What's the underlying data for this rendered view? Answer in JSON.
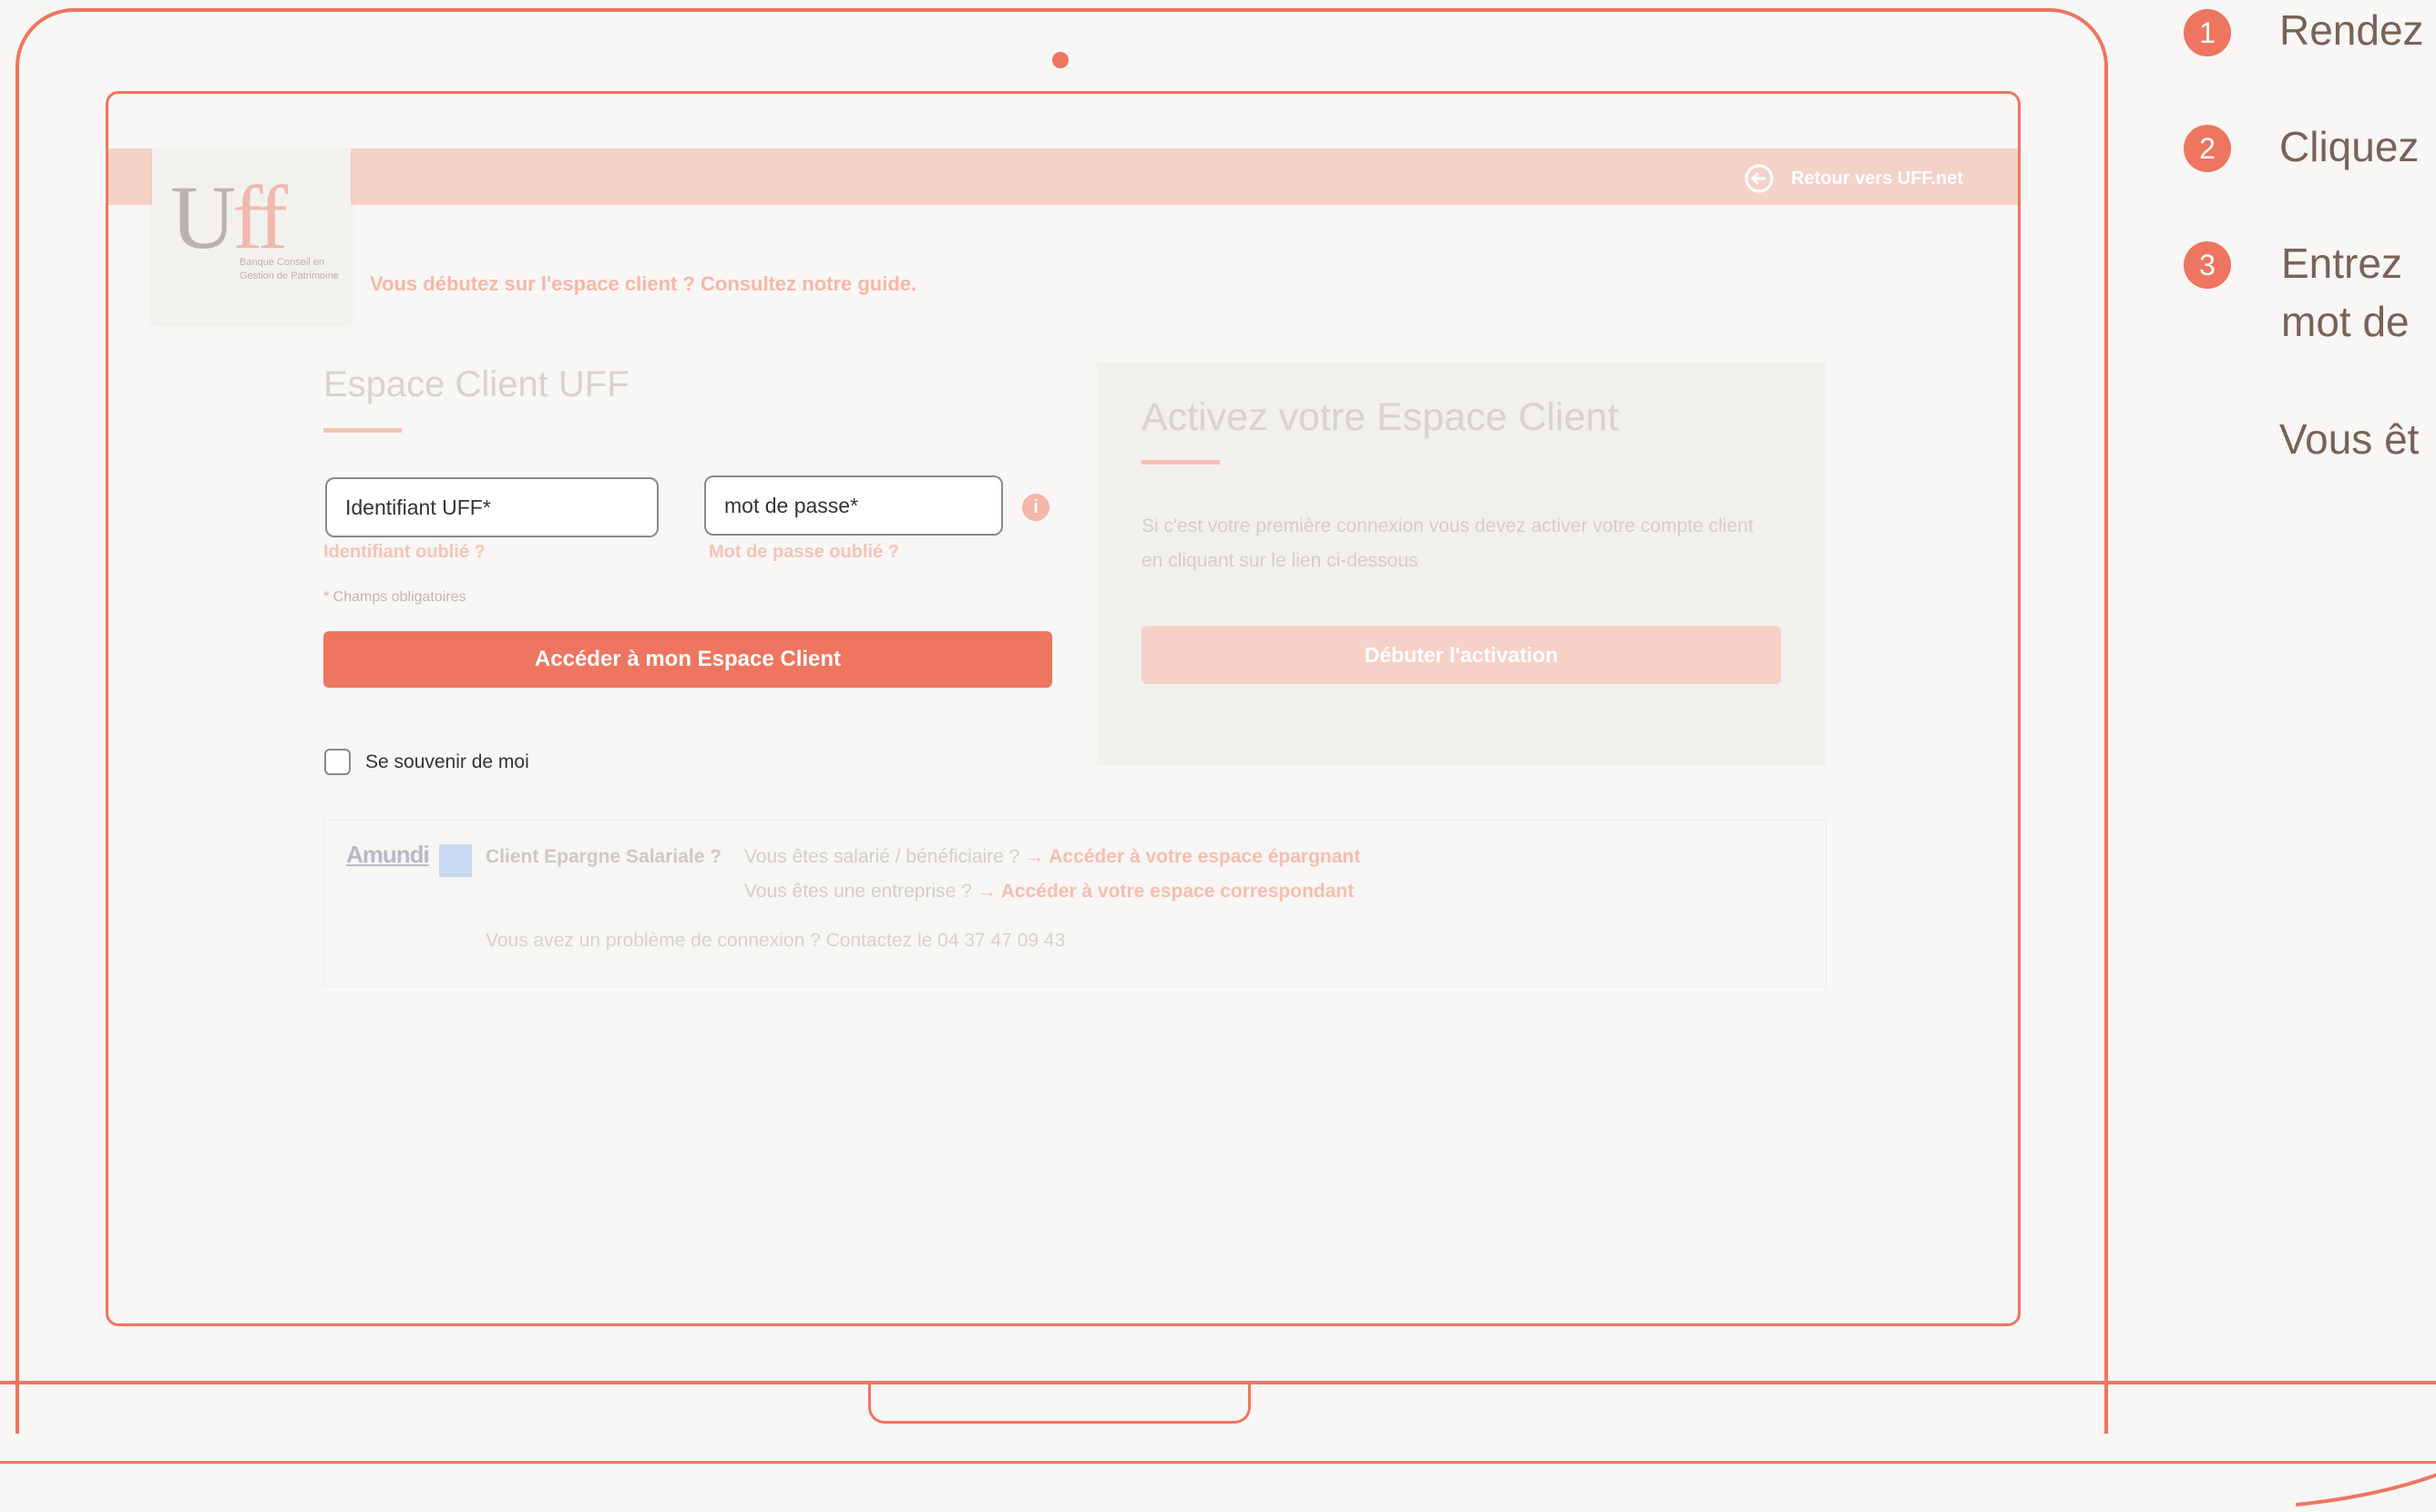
{
  "page": {
    "retour_label": "Retour vers UFF.net",
    "logo": {
      "mark_u": "U",
      "mark_ff": "ff",
      "subtitle": "Banque Conseil en Gestion de Patrimoine"
    },
    "guide_link": "Vous débutez sur l'espace client ? Consultez notre guide.",
    "login": {
      "title": "Espace Client UFF",
      "identifiant_placeholder": "Identifiant UFF*",
      "password_placeholder": "mot de passe*",
      "forgot_identifiant": "Identifiant oublié ?",
      "forgot_password": "Mot de passe oublié ?",
      "required_note": "* Champs obligatoires",
      "access_button": "Accéder à mon Espace Client",
      "remember_label": "Se souvenir de moi"
    },
    "activation": {
      "title": "Activez votre Espace Client",
      "description": "Si c'est votre première connexion vous devez activer votre compte client en cliquant sur le lien ci-dessous",
      "button": "Débuter l'activation"
    },
    "epargne": {
      "brand": "Amundi",
      "label": "Client Epargne Salariale ?",
      "line1_text": "Vous êtes salarié / bénéficiaire ?",
      "line1_link": "→ Accéder à votre espace épargnant",
      "line2_text": "Vous êtes une entreprise ?",
      "line2_link": "→ Accéder à votre espace correspondant",
      "contact": "Vous avez un problème de connexion ? Contactez le 04 37 47 09 43"
    }
  },
  "steps": [
    {
      "num": "1",
      "text": "Rendez"
    },
    {
      "num": "2",
      "text": "Cliquez"
    },
    {
      "num": "3",
      "text": "Entrez",
      "text2": "mot de"
    }
  ],
  "note": "Vous êt",
  "colors": {
    "accent": "#ee7560",
    "accent_light": "#f5d2c8"
  }
}
